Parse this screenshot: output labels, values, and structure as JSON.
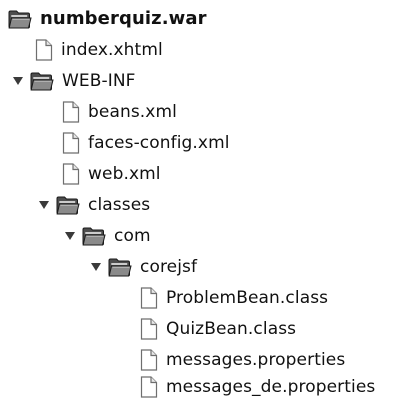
{
  "tree": {
    "root": {
      "label": "numberquiz.war",
      "icon": "folder-open-icon"
    },
    "items": [
      {
        "label": "index.xhtml",
        "icon": "file-icon"
      },
      {
        "label": "WEB-INF",
        "icon": "folder-open-icon",
        "expanded": true
      },
      {
        "label": "beans.xml",
        "icon": "file-icon"
      },
      {
        "label": "faces-config.xml",
        "icon": "file-icon"
      },
      {
        "label": "web.xml",
        "icon": "file-icon"
      },
      {
        "label": "classes",
        "icon": "folder-open-icon",
        "expanded": true
      },
      {
        "label": "com",
        "icon": "folder-open-icon",
        "expanded": true
      },
      {
        "label": "corejsf",
        "icon": "folder-open-icon",
        "expanded": true
      },
      {
        "label": "ProblemBean.class",
        "icon": "file-icon"
      },
      {
        "label": "QuizBean.class",
        "icon": "file-icon"
      },
      {
        "label": "messages.properties",
        "icon": "file-icon"
      },
      {
        "label": "messages_de.properties",
        "icon": "file-icon"
      }
    ]
  }
}
